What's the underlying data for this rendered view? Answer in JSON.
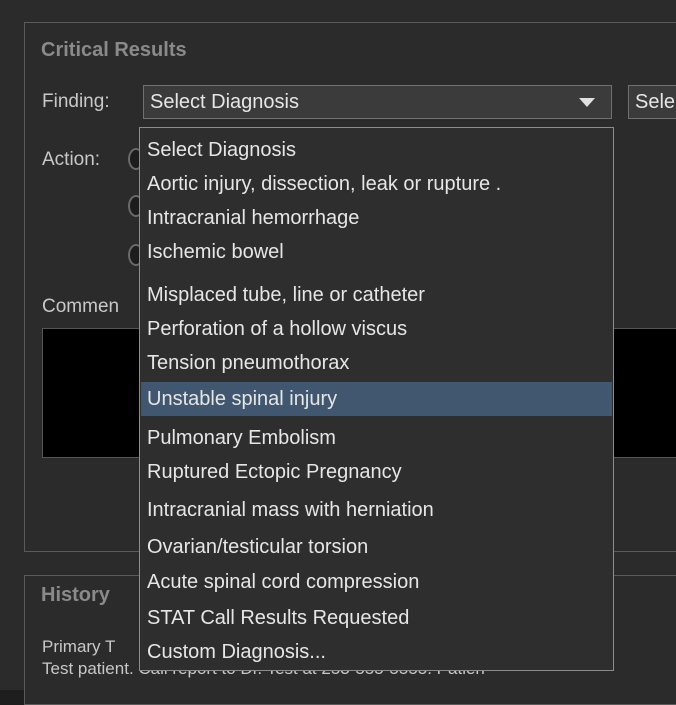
{
  "critical": {
    "title": "Critical Results",
    "finding_label": "Finding:",
    "finding_value": "Select Diagnosis",
    "second_combo_value": "Sele",
    "action_label": "Action:",
    "comments_label": "Commen"
  },
  "history": {
    "title": "History",
    "line1": "Primary T",
    "line2": "Test patient. Call report to Dr. Test at 253-555-5555. Patien"
  },
  "dropdown": {
    "options": [
      "Select Diagnosis",
      "Aortic injury, dissection, leak or rupture  .",
      "Intracranial hemorrhage",
      "Ischemic bowel",
      "Misplaced tube, line or catheter",
      "Perforation of a hollow viscus",
      "Tension pneumothorax",
      "Unstable spinal injury",
      "Pulmonary Embolism",
      "Ruptured Ectopic Pregnancy",
      "Intracranial mass with herniation",
      "Ovarian/testicular torsion",
      "Acute spinal cord compression",
      "STAT Call Results Requested",
      "Custom Diagnosis..."
    ],
    "highlighted": "Unstable spinal injury"
  }
}
